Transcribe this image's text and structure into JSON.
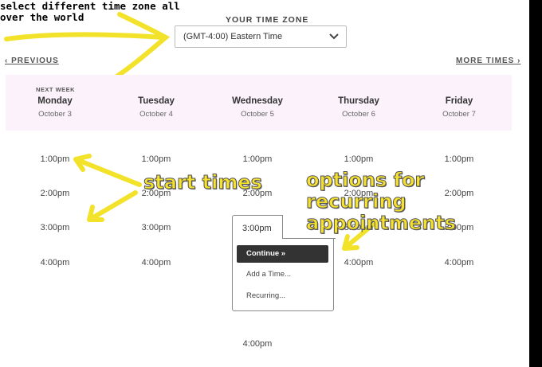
{
  "annotation": {
    "top_note": "select different time zone all over the world"
  },
  "timezone": {
    "label": "YOUR TIME ZONE",
    "selected": "(GMT-4:00) Eastern Time"
  },
  "nav": {
    "previous": "PREVIOUS",
    "more": "MORE TIMES"
  },
  "week_label": "NEXT WEEK",
  "days": [
    {
      "name": "Monday",
      "date": "October 3"
    },
    {
      "name": "Tuesday",
      "date": "October 4"
    },
    {
      "name": "Wednesday",
      "date": "October 5"
    },
    {
      "name": "Thursday",
      "date": "October 6"
    },
    {
      "name": "Friday",
      "date": "October 7"
    }
  ],
  "slots": {
    "monday": [
      "1:00pm",
      "2:00pm",
      "3:00pm",
      "4:00pm"
    ],
    "tuesday": [
      "1:00pm",
      "2:00pm",
      "3:00pm",
      "4:00pm"
    ],
    "wednesday": [
      "1:00pm",
      "2:00pm",
      "4:00pm"
    ],
    "thursday": [
      "1:00pm",
      "2:00pm",
      "3:00pm",
      "4:00pm"
    ],
    "friday": [
      "1:00pm",
      "2:00pm",
      "3:00pm",
      "4:00pm"
    ]
  },
  "popup": {
    "time": "3:00pm",
    "continue": "Continue »",
    "add_time": "Add a Time...",
    "recurring": "Recurring..."
  },
  "callouts": {
    "start_times": "start times",
    "options_line1": "options for recurring",
    "options_line2": "appointments"
  },
  "colors": {
    "highlight": "#f6e12c",
    "week_band": "#fbf2fb",
    "continue_bg": "#333333"
  }
}
